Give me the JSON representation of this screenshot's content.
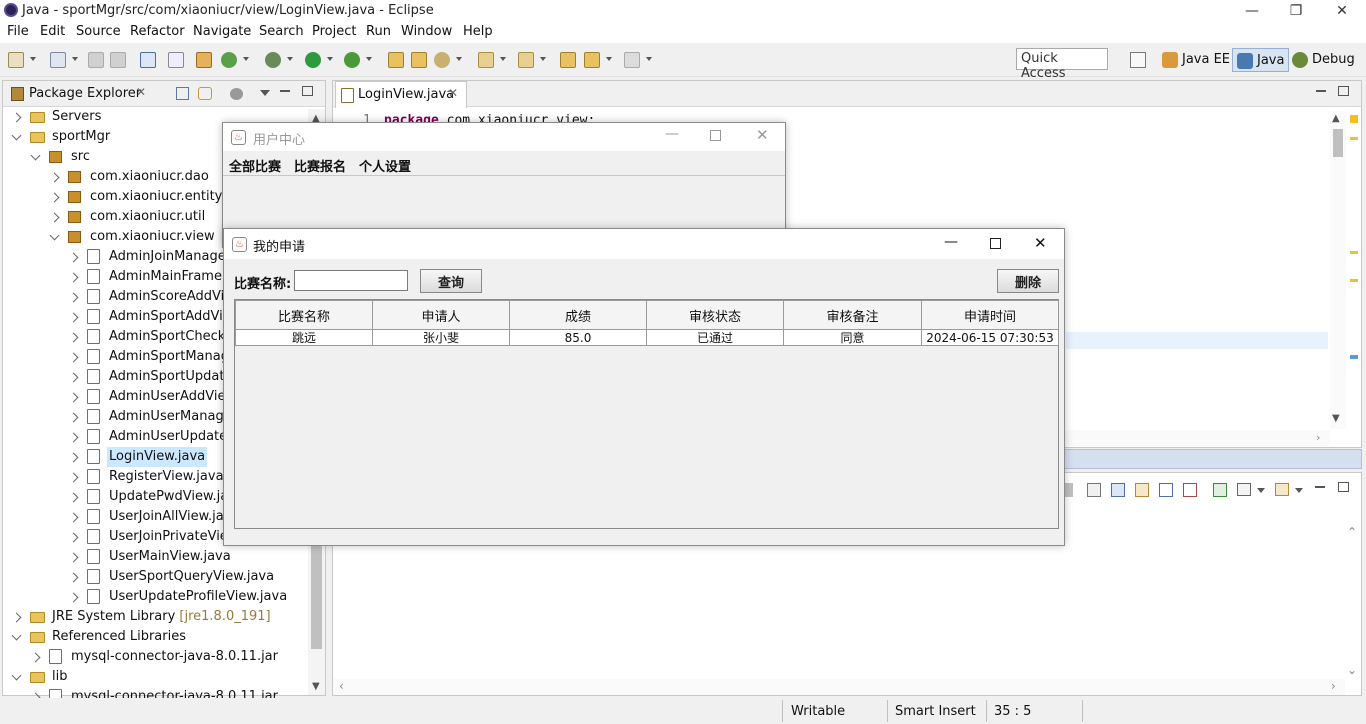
{
  "window": {
    "title": "Java - sportMgr/src/com/xiaoniucr/view/LoginView.java - Eclipse",
    "minimize": "—",
    "restore": "❐",
    "close": "✕"
  },
  "menu": [
    "File",
    "Edit",
    "Source",
    "Refactor",
    "Navigate",
    "Search",
    "Project",
    "Run",
    "Window",
    "Help"
  ],
  "toolbar": {
    "quick_access": "Quick Access",
    "perspectives": [
      "Java EE",
      "Java",
      "Debug"
    ]
  },
  "package_explorer": {
    "title": "Package Explorer",
    "tree": [
      {
        "label": "Servers",
        "expanded": false
      },
      {
        "label": "sportMgr",
        "expanded": true
      },
      {
        "label": "src",
        "expanded": true
      },
      {
        "label": "com.xiaoniucr.dao",
        "expanded": false
      },
      {
        "label": "com.xiaoniucr.entity",
        "expanded": false
      },
      {
        "label": "com.xiaoniucr.util",
        "expanded": false
      },
      {
        "label": "com.xiaoniucr.view",
        "expanded": true
      },
      {
        "label": "AdminJoinManageV"
      },
      {
        "label": "AdminMainFrame.jav"
      },
      {
        "label": "AdminScoreAddView"
      },
      {
        "label": "AdminSportAddView"
      },
      {
        "label": "AdminSportCheckVi"
      },
      {
        "label": "AdminSportManage"
      },
      {
        "label": "AdminSportUpdateV"
      },
      {
        "label": "AdminUserAddView."
      },
      {
        "label": "AdminUserManageV"
      },
      {
        "label": "AdminUserUpdateVi"
      },
      {
        "label": "LoginView.java",
        "selected": true
      },
      {
        "label": "RegisterView.java"
      },
      {
        "label": "UpdatePwdView.java"
      },
      {
        "label": "UserJoinAllView.java"
      },
      {
        "label": "UserJoinPrivateView."
      },
      {
        "label": "UserMainView.java"
      },
      {
        "label": "UserSportQueryView.java"
      },
      {
        "label": "UserUpdateProfileView.java"
      },
      {
        "label": "JRE System Library",
        "suffix": "[jre1.8.0_191]"
      },
      {
        "label": "Referenced Libraries",
        "expanded": true
      },
      {
        "label": "mysql-connector-java-8.0.11.jar"
      },
      {
        "label": "lib",
        "expanded": true
      },
      {
        "label": "mysql-connector-java-8.0.11.jar"
      }
    ]
  },
  "editor": {
    "tab": "LoginView.java",
    "line_no": "1",
    "code_kw": "package",
    "code_rest": " com.xiaoniucr.view;"
  },
  "status": {
    "writable": "Writable",
    "insert_mode": "Smart Insert",
    "position": "35 : 5"
  },
  "user_center": {
    "title": "用户中心",
    "menu": [
      "全部比赛",
      "比赛报名",
      "个人设置"
    ]
  },
  "my_applications": {
    "title": "我的申请",
    "search_label": "比赛名称:",
    "search_value": "",
    "query_button": "查询",
    "delete_button": "删除",
    "columns": [
      "比赛名称",
      "申请人",
      "成绩",
      "审核状态",
      "审核备注",
      "申请时间"
    ],
    "rows": [
      [
        "跳远",
        "张小斐",
        "85.0",
        "已通过",
        "同意",
        "2024-06-15 07:30:53"
      ]
    ]
  },
  "colors": {
    "keyword": "#7f0055",
    "selection": "#cce8ff"
  }
}
